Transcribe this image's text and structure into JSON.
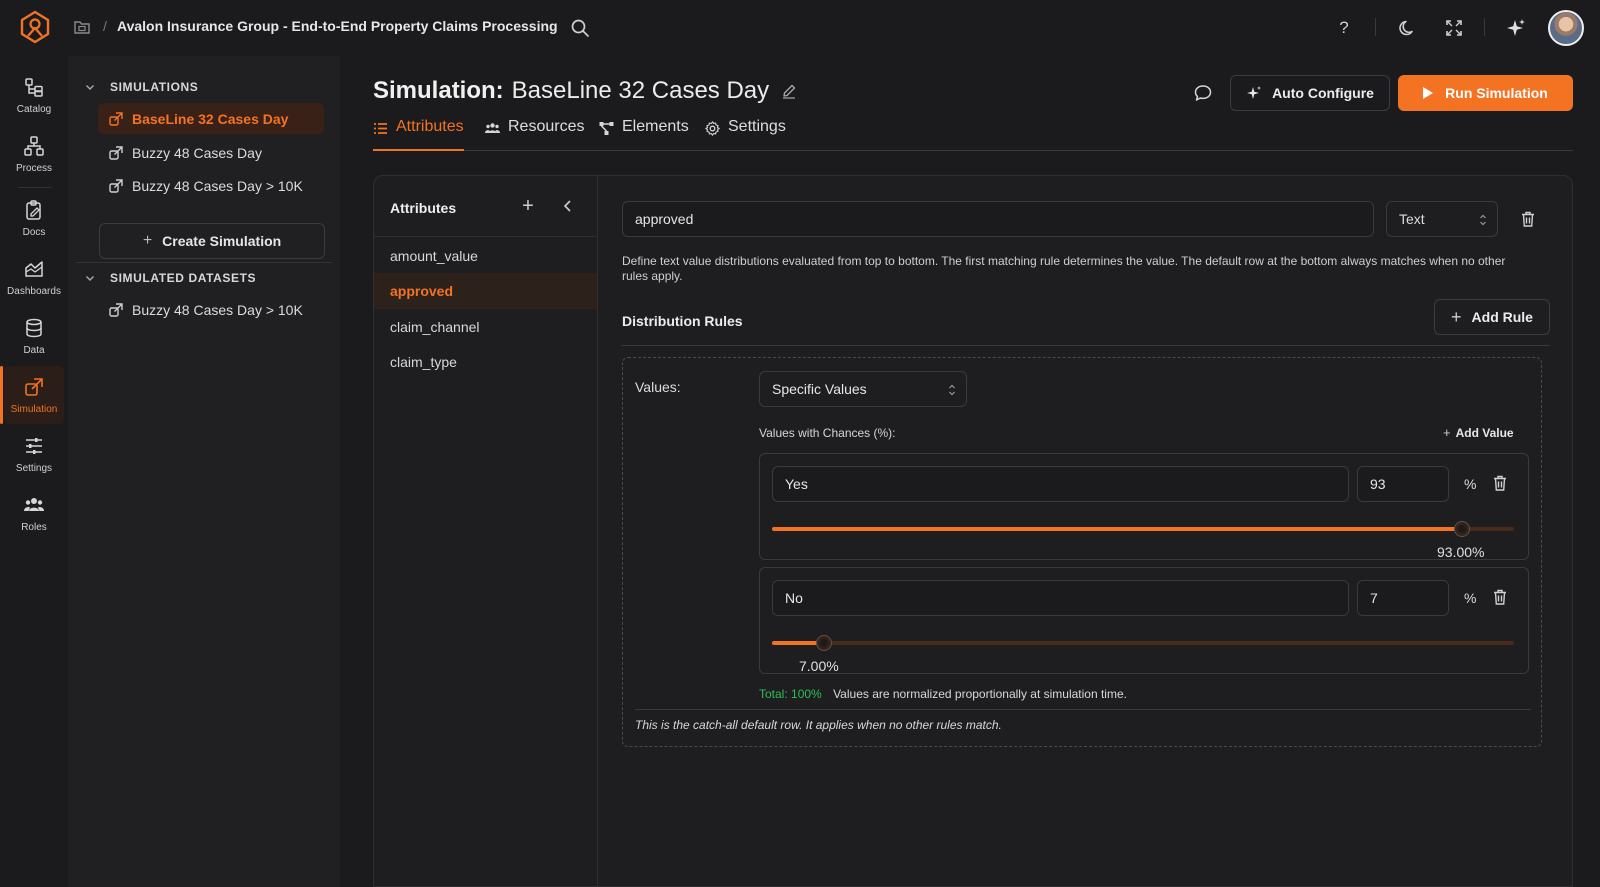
{
  "header": {
    "project_title": "Avalon Insurance Group - End-to-End Property Claims Processing"
  },
  "nav": {
    "items": [
      {
        "label": "Catalog",
        "icon": "catalog-icon"
      },
      {
        "label": "Process",
        "icon": "process-icon"
      },
      {
        "label": "Docs",
        "icon": "docs-icon"
      },
      {
        "label": "Dashboards",
        "icon": "dashboards-icon"
      },
      {
        "label": "Data",
        "icon": "database-icon"
      },
      {
        "label": "Simulation",
        "icon": "simulation-icon"
      },
      {
        "label": "Settings",
        "icon": "sliders-icon"
      },
      {
        "label": "Roles",
        "icon": "users-icon"
      }
    ],
    "active": "Simulation"
  },
  "sidebar": {
    "simulations_heading": "SIMULATIONS",
    "simulations": [
      {
        "label": "BaseLine 32 Cases Day",
        "active": true
      },
      {
        "label": "Buzzy 48 Cases Day",
        "active": false
      },
      {
        "label": "Buzzy 48 Cases Day > 10K",
        "active": false
      }
    ],
    "create_label": "Create Simulation",
    "datasets_heading": "SIMULATED DATASETS",
    "datasets": [
      {
        "label": "Buzzy 48 Cases Day > 10K"
      }
    ]
  },
  "main": {
    "title_prefix": "Simulation:",
    "title_name": "BaseLine 32 Cases Day",
    "auto_configure_label": "Auto Configure",
    "run_label": "Run Simulation",
    "tabs": [
      {
        "label": "Attributes",
        "icon": "list-icon",
        "active": true
      },
      {
        "label": "Resources",
        "icon": "users-icon",
        "active": false
      },
      {
        "label": "Elements",
        "icon": "flow-icon",
        "active": false
      },
      {
        "label": "Settings",
        "icon": "gear-icon",
        "active": false
      }
    ]
  },
  "attributes": {
    "heading": "Attributes",
    "items": [
      {
        "label": "amount_value",
        "active": false
      },
      {
        "label": "approved",
        "active": true
      },
      {
        "label": "claim_channel",
        "active": false
      },
      {
        "label": "claim_type",
        "active": false
      }
    ]
  },
  "editor": {
    "name_value": "approved",
    "type_value": "Text",
    "description": "Define text value distributions evaluated from top to bottom. The first matching rule determines the value. The default row at the bottom always matches when no other rules apply.",
    "distribution_title": "Distribution Rules",
    "add_rule_label": "Add Rule",
    "rule": {
      "values_label": "Values:",
      "mode_value": "Specific Values",
      "chances_label": "Values with Chances (%):",
      "add_value_label": "Add Value",
      "values": [
        {
          "name": "Yes",
          "percent": "93",
          "display": "93.00%",
          "fraction": 0.93
        },
        {
          "name": "No",
          "percent": "7",
          "display": "7.00%",
          "fraction": 0.07
        }
      ],
      "percent_sign": "%",
      "total_text": "Total: 100%",
      "normalize_text": "Values are normalized proportionally at simulation time.",
      "catch_all_text": "This is the catch-all default row. It applies when no other rules match."
    }
  },
  "colors": {
    "accent": "#f37323",
    "success": "#2ebd59",
    "background": "#1b1b1d"
  }
}
